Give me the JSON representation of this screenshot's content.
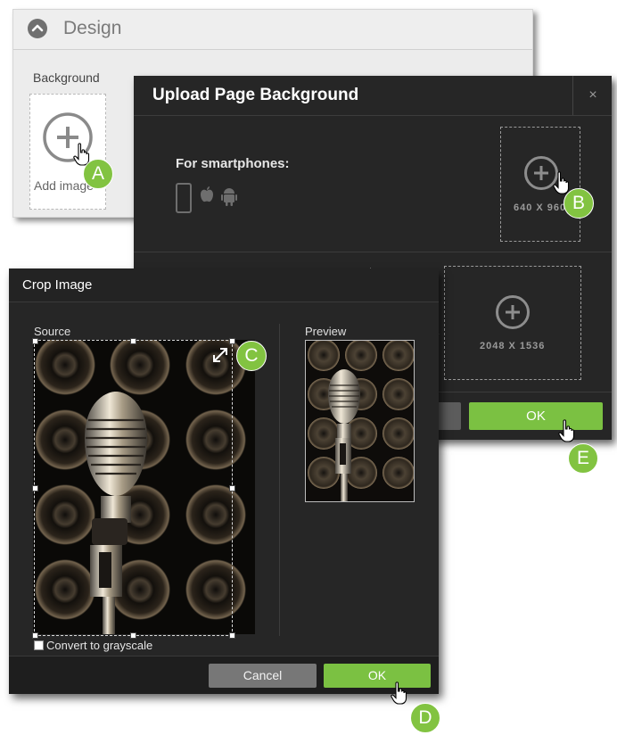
{
  "design_panel": {
    "title": "Design",
    "background_label": "Background",
    "add_image_label": "Add image"
  },
  "upload_dialog": {
    "title": "Upload Page Background",
    "close_label": "×",
    "smartphones_label": "For smartphones:",
    "phone_size": "640 X 960",
    "tablet_size": "2048 X 1536",
    "ok_label": "OK"
  },
  "crop_dialog": {
    "title": "Crop Image",
    "source_label": "Source",
    "preview_label": "Preview",
    "grayscale_label": "Convert to grayscale",
    "grayscale_checked": false,
    "cancel_label": "Cancel",
    "ok_label": "OK"
  },
  "callouts": [
    "A",
    "B",
    "C",
    "D",
    "E"
  ],
  "icons": [
    "chevron-up-icon",
    "plus-circle-icon",
    "hand-cursor-icon",
    "smartphone-icon",
    "apple-icon",
    "android-icon",
    "resize-icon"
  ],
  "colors": {
    "accent_green": "#7bc142",
    "dialog_bg": "#262626",
    "button_gray": "#777777"
  }
}
